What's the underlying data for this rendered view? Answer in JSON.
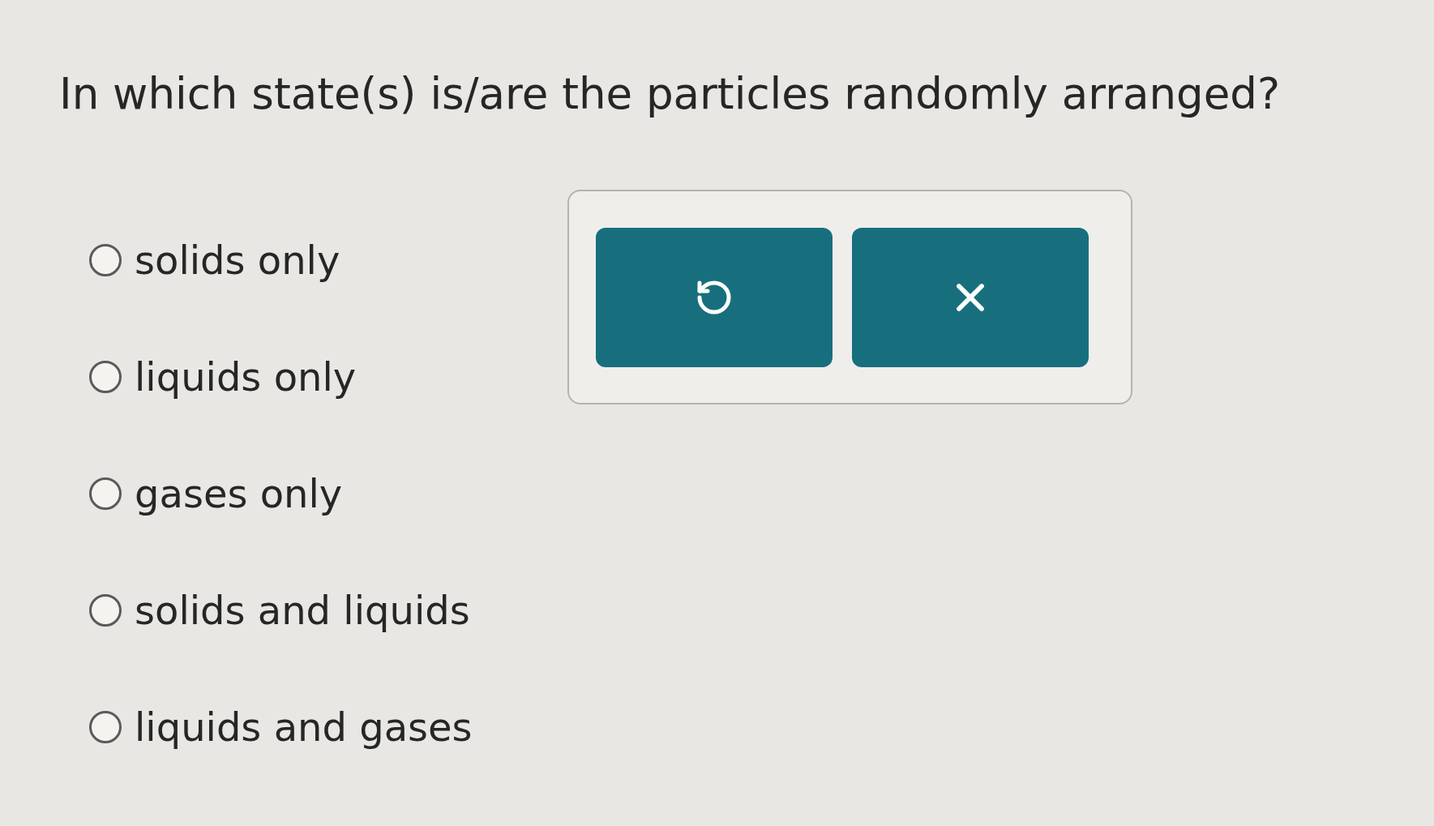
{
  "question": "In which state(s) is/are the particles randomly arranged?",
  "options": [
    {
      "label": "solids only",
      "selected": false
    },
    {
      "label": "liquids only",
      "selected": false
    },
    {
      "label": "gases only",
      "selected": false
    },
    {
      "label": "solids and liquids",
      "selected": false
    },
    {
      "label": "liquids and gases",
      "selected": false
    }
  ]
}
